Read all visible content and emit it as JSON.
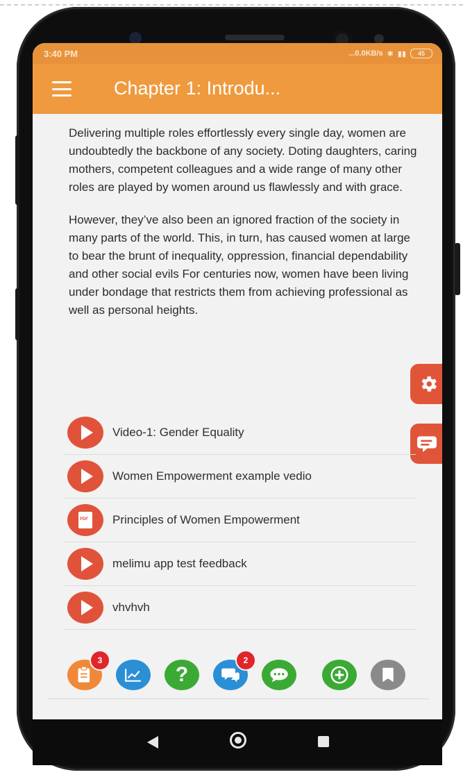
{
  "status_bar": {
    "time": "3:40 PM",
    "network_speed": "...0.0KB/s",
    "battery": "45"
  },
  "app_bar": {
    "title": "Chapter 1: Introdu..."
  },
  "content": {
    "paragraphs": [
      "Delivering multiple roles effortlessly every single day, women are undoubtedly the backbone of any society. Doting daughters, caring mothers, competent colleagues and a wide range of many other roles are played by women around us flawlessly and with grace.",
      "However, they’ve also been an ignored fraction of the society in many parts of the world. This, in turn, has caused women at large to bear the brunt of inequality, oppression, financial dependability and other social evils For centuries now, women have been living under bondage that restricts them from achieving professional as well as personal heights."
    ]
  },
  "floating_buttons": {
    "settings": "gear-icon",
    "chat": "chat-bubble-icon"
  },
  "resources": [
    {
      "label": "Video-1: Gender Equality",
      "icon": "play-icon"
    },
    {
      "label": "Women Empowerment example vedio",
      "icon": "play-icon"
    },
    {
      "label": "Principles of Women Empowerment",
      "icon": "pdf-icon"
    },
    {
      "label": "melimu app test feedback",
      "icon": "play-icon"
    },
    {
      "label": "vhvhvh",
      "icon": "play-icon"
    }
  ],
  "bottom_toolbar": {
    "notes": {
      "icon": "notes-icon",
      "color": "#f0883a",
      "badge": "3"
    },
    "progress": {
      "icon": "chart-icon",
      "color": "#2b8fd6"
    },
    "help": {
      "icon": "question-icon",
      "color": "#3aaa35"
    },
    "discussion": {
      "icon": "discussion-icon",
      "color": "#2b8fd6",
      "badge": "2"
    },
    "messages": {
      "icon": "message-icon",
      "color": "#3aaa35"
    },
    "add": {
      "icon": "plus-icon",
      "color": "#3aaa35"
    },
    "bookmark": {
      "icon": "bookmark-icon",
      "color": "#8a8a8a"
    }
  },
  "colors": {
    "app_bar": "#ef9a3e",
    "accent_red": "#e0533a",
    "badge": "#e0262b"
  }
}
